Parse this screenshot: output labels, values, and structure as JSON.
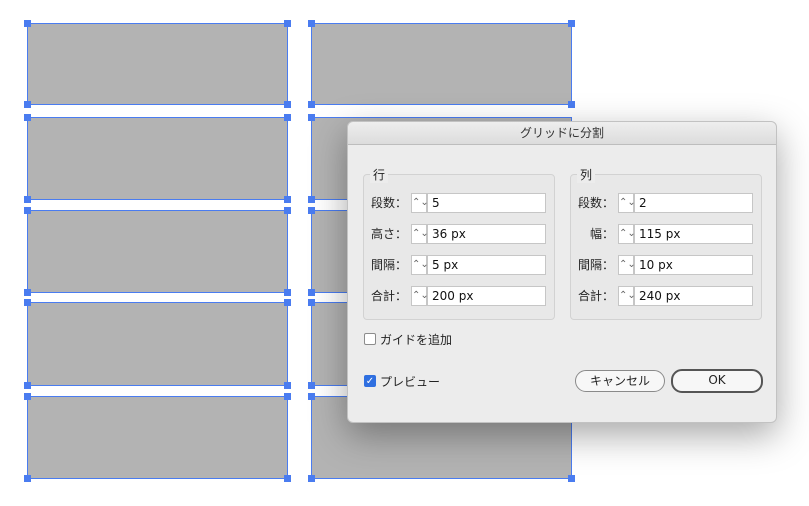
{
  "dialog": {
    "title": "グリッドに分割",
    "rows": {
      "group_title": "行",
      "count": {
        "label": "段数：",
        "value": "5"
      },
      "height": {
        "label": "高さ：",
        "value": "36 px"
      },
      "gutter": {
        "label": "間隔：",
        "value": "5 px"
      },
      "total": {
        "label": "合計：",
        "value": "200 px"
      }
    },
    "columns": {
      "group_title": "列",
      "count": {
        "label": "段数：",
        "value": "2"
      },
      "width": {
        "label": "幅：",
        "value": "115 px"
      },
      "gutter": {
        "label": "間隔：",
        "value": "10 px"
      },
      "total": {
        "label": "合計：",
        "value": "240 px"
      }
    },
    "add_guides": {
      "label": "ガイドを追加",
      "checked": false
    },
    "preview": {
      "label": "プレビュー",
      "checked": true
    },
    "cancel_label": "キャンセル",
    "ok_label": "OK"
  },
  "colors": {
    "selection": "#4a7cf0",
    "rect_fill": "#b3b3b3",
    "dialog_bg": "#ececec"
  },
  "icons": {
    "stepper": "up-down-chevron-icon",
    "check": "checkmark-icon"
  }
}
